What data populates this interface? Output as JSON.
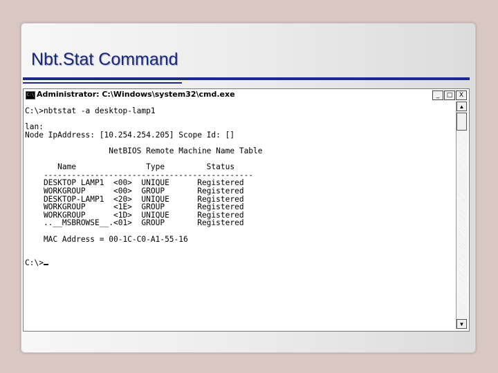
{
  "slide": {
    "title": "Nbt.Stat Command"
  },
  "window": {
    "title": "Administrator: C:\\Windows\\system32\\cmd.exe",
    "icon_text": "C:\\",
    "minimize_glyph": "_",
    "maximize_glyph": "□",
    "close_glyph": "X"
  },
  "console": {
    "lines": [
      "C:\\>nbtstat -a desktop-lamp1",
      "",
      "lan:",
      "Node IpAddress: [10.254.254.205] Scope Id: []",
      "",
      "                  NetBIOS Remote Machine Name Table",
      "",
      "       Name               Type         Status",
      "    ---------------------------------------------",
      "    DESKTOP LAMP1  <00>  UNIQUE      Registered",
      "    WORKGROUP      <00>  GROUP       Registered",
      "    DESKTOP-LAMP1  <20>  UNIQUE      Registered",
      "    WORKGROUP      <1E>  GROUP       Registered",
      "    WORKGROUP      <1D>  UNIQUE      Registered",
      "    ..__MSBROWSE__.<01>  GROUP       Registered",
      "",
      "    MAC Address = 00-1C-C0-A1-55-16",
      "",
      "",
      "C:\\>"
    ]
  },
  "scrollbar": {
    "up_glyph": "▲",
    "down_glyph": "▼"
  }
}
